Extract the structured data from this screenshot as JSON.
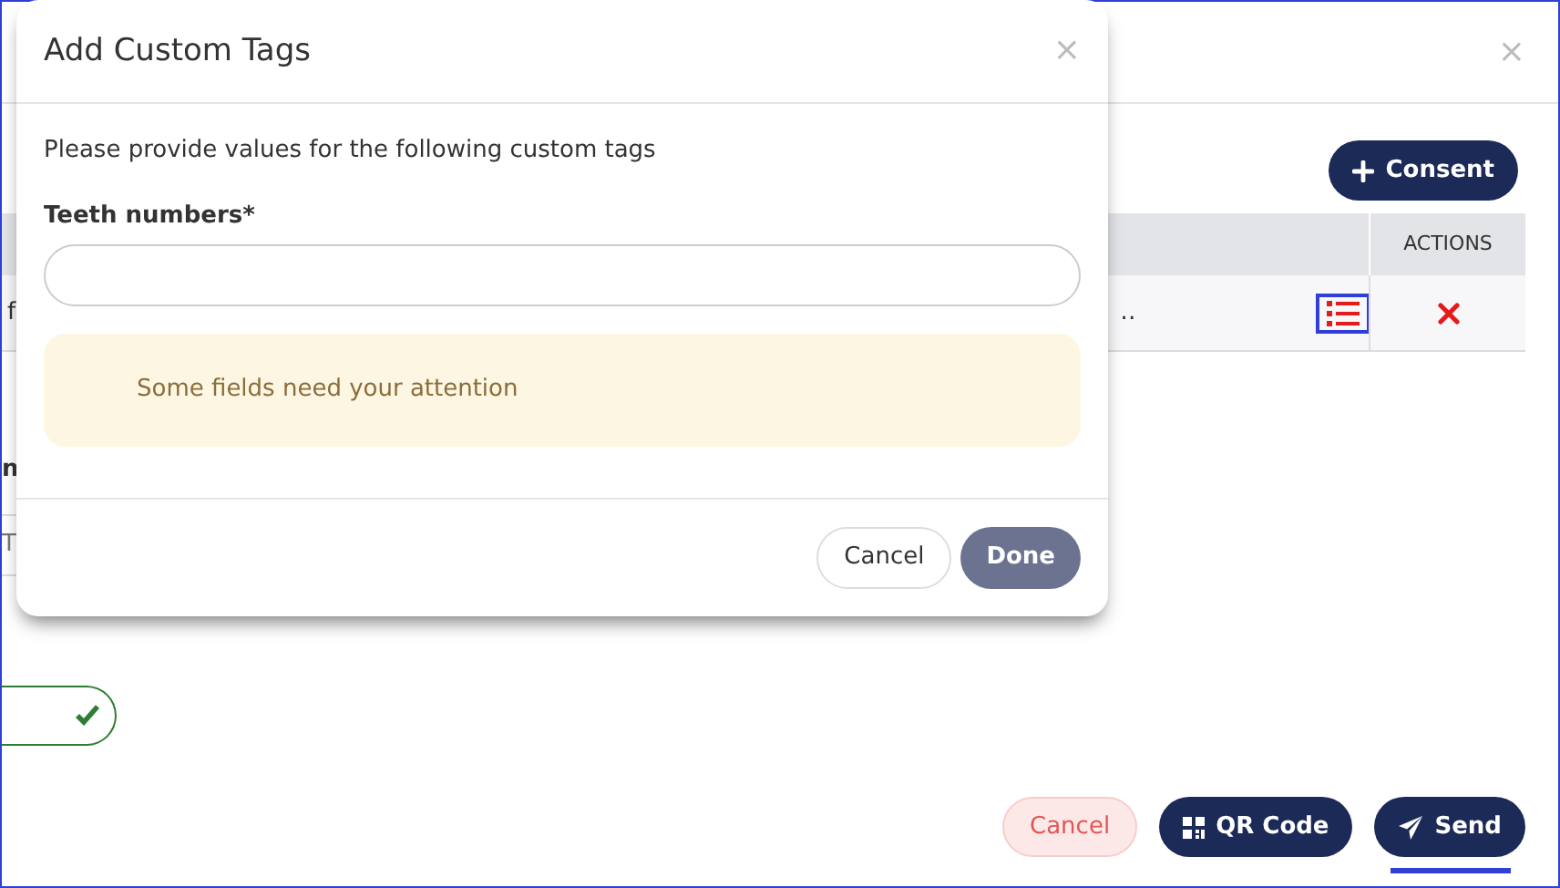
{
  "background": {
    "close": "×",
    "consent_button": {
      "label": "Consent"
    },
    "table": {
      "columns": [
        "",
        "ACTIONS"
      ],
      "rows": [
        {
          "cells": [
            "f",
            "‥"
          ],
          "actions": [
            {
              "kind": "list",
              "focused": true
            },
            {
              "kind": "delete",
              "focused": false
            }
          ]
        }
      ]
    },
    "section_label": "n",
    "field_placeholder": "T",
    "footer_buttons": [
      {
        "label": "Cancel",
        "kind": "cancel",
        "focused": false
      },
      {
        "label": "QR Code",
        "kind": "qr",
        "focused": false
      },
      {
        "label": "Send",
        "kind": "send",
        "focused": true
      }
    ]
  },
  "dialog": {
    "title": "Add Custom Tags",
    "close": "×",
    "instruction": "Please provide values for the following custom tags",
    "fields": [
      {
        "label": "Teeth numbers*"
      }
    ],
    "alert": "Some fields need your attention",
    "buttons": [
      {
        "label": "Cancel",
        "kind": "secondary",
        "disabled": false
      },
      {
        "label": "Done",
        "kind": "primary",
        "disabled": true
      }
    ]
  }
}
